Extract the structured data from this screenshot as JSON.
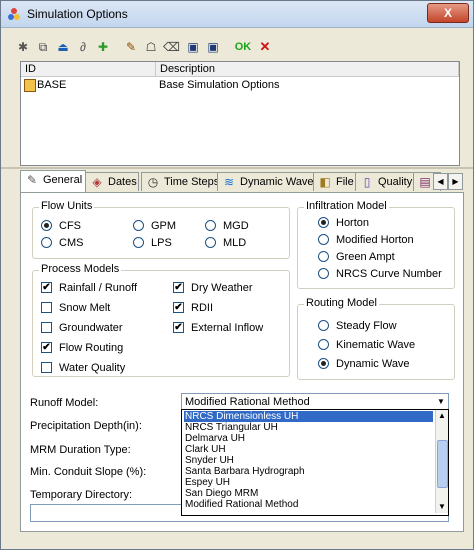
{
  "window": {
    "title": "Simulation Options",
    "close_glyph": "X"
  },
  "toolbar": {
    "buttons": [
      {
        "name": "new-icon",
        "glyph": "✱"
      },
      {
        "name": "copy-icon",
        "glyph": "⧉"
      },
      {
        "name": "import-icon",
        "glyph": "⏏"
      },
      {
        "name": "link-icon",
        "glyph": "∂"
      },
      {
        "name": "add-icon",
        "glyph": "✚"
      },
      {
        "name": "edit-icon",
        "glyph": "✎"
      },
      {
        "name": "paste-icon",
        "glyph": "☖"
      },
      {
        "name": "erase-icon",
        "glyph": "⌫"
      },
      {
        "name": "save-icon",
        "glyph": "▣"
      },
      {
        "name": "save-all-icon",
        "glyph": "▣"
      }
    ],
    "ok_label": "OK",
    "cancel_glyph": "✕"
  },
  "scenario_list": {
    "columns": [
      "ID",
      "Description"
    ],
    "rows": [
      {
        "id": "BASE",
        "description": "Base Simulation Options"
      }
    ]
  },
  "tabs": [
    {
      "label": "General",
      "icon": "✎"
    },
    {
      "label": "Dates",
      "icon": "◈"
    },
    {
      "label": "Time Steps",
      "icon": "◷"
    },
    {
      "label": "Dynamic Wave",
      "icon": "≋"
    },
    {
      "label": "File",
      "icon": "◧"
    },
    {
      "label": "Quality",
      "icon": "▯"
    },
    {
      "label": "",
      "icon": "▤"
    }
  ],
  "tab_scroll": {
    "left": "◀",
    "right": "▶"
  },
  "flow_units": {
    "title": "Flow Units",
    "options": [
      {
        "label": "CFS",
        "selected": true
      },
      {
        "label": "GPM",
        "selected": false
      },
      {
        "label": "MGD",
        "selected": false
      },
      {
        "label": "CMS",
        "selected": false
      },
      {
        "label": "LPS",
        "selected": false
      },
      {
        "label": "MLD",
        "selected": false
      }
    ]
  },
  "infiltration_model": {
    "title": "Infiltration Model",
    "options": [
      {
        "label": "Horton",
        "selected": true
      },
      {
        "label": "Modified Horton",
        "selected": false
      },
      {
        "label": "Green Ampt",
        "selected": false
      },
      {
        "label": "NRCS Curve Number",
        "selected": false
      }
    ]
  },
  "process_models": {
    "title": "Process Models",
    "items": [
      {
        "label": "Rainfall / Runoff",
        "checked": true
      },
      {
        "label": "Dry Weather",
        "checked": true
      },
      {
        "label": "Snow Melt",
        "checked": false
      },
      {
        "label": "RDII",
        "checked": true
      },
      {
        "label": "Groundwater",
        "checked": false
      },
      {
        "label": "External Inflow",
        "checked": true
      },
      {
        "label": "Flow Routing",
        "checked": true
      },
      {
        "label": "Water Quality",
        "checked": false
      }
    ]
  },
  "routing_model": {
    "title": "Routing Model",
    "options": [
      {
        "label": "Steady Flow",
        "selected": false
      },
      {
        "label": "Kinematic Wave",
        "selected": false
      },
      {
        "label": "Dynamic Wave",
        "selected": true
      }
    ]
  },
  "check_glyph": "✔",
  "form": {
    "runoff_model_label": "Runoff Model:",
    "runoff_model_value": "Modified Rational Method",
    "precip_depth_label": "Precipitation Depth(in):",
    "mrm_duration_label": "MRM Duration Type:",
    "min_slope_label": "Min. Conduit Slope (%):",
    "temp_dir_label": "Temporary Directory:",
    "dropdown_arrow": "▼"
  },
  "dropdown": {
    "options": [
      "NRCS Dimensionless UH",
      "NRCS Triangular UH",
      "Delmarva UH",
      "Clark UH",
      "Snyder UH",
      "Santa Barbara Hydrograph",
      "Espey UH",
      "San Diego MRM",
      "Modified Rational Method"
    ],
    "highlighted_index": 0,
    "scroll_up": "▲",
    "scroll_down": "▼"
  }
}
